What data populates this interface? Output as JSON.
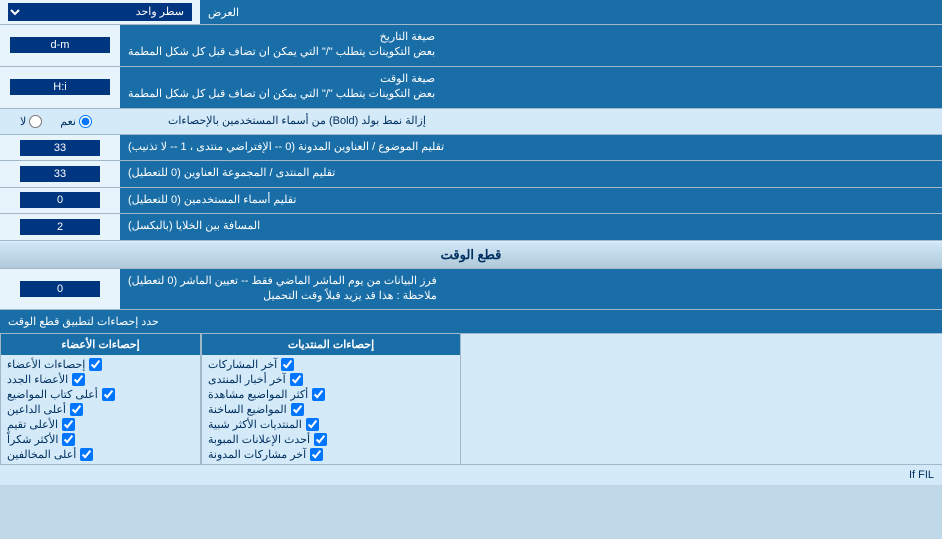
{
  "header": {
    "display_label": "العرض",
    "display_value": "سطر واحد"
  },
  "rows": [
    {
      "label": "صيغة التاريخ\nبعض التكوينات يتطلب \"/\" التي يمكن ان تضاف قبل كل شكل المطمة",
      "input_value": "d-m",
      "input_type": "text"
    },
    {
      "label": "صيغة الوقت\nبعض التكوينات يتطلب \"/\" التي يمكن ان تضاف قبل كل شكل المطمة",
      "input_value": "H:i",
      "input_type": "text"
    }
  ],
  "bold_label": "إزالة نمط بولد (Bold) من أسماء المستخدمين بالإحصاءات",
  "bold_yes": "نعم",
  "bold_no": "لا",
  "rows2": [
    {
      "label": "تقليم الموضوع / العناوين المدونة (0 -- الإفتراضي منتدى ، 1 -- لا تذنيب)",
      "input_value": "33"
    },
    {
      "label": "تقليم المنتدى / المجموعة العناوين (0 للتعطيل)",
      "input_value": "33"
    },
    {
      "label": "تقليم أسماء المستخدمين (0 للتعطيل)",
      "input_value": "0"
    },
    {
      "label": "المسافة بين الخلايا (بالبكسل)",
      "input_value": "2"
    }
  ],
  "section_cutoff": "قطع الوقت",
  "cutoff_row": {
    "label": "فرز البيانات من يوم الماشر الماضي فقط -- تعيين الماشر (0 لتعطيل)\nملاحظة : هذا قد يزيد قبلاً وقت التحميل",
    "input_value": "0"
  },
  "limit_label": "حدد إحصاءات لتطبيق قطع الوقت",
  "checkbox_headers": {
    "col1": "إحصاءات المنتديات",
    "col2": "إحصاءات الأعضاء"
  },
  "checkbox_col1": [
    "آخر المشاركات",
    "آخر أخبار المنتدى",
    "أكثر المواضيع مشاهدة",
    "المواضيع الساخنة",
    "المنتديات الأكثر شبية",
    "أحدث الإعلانات المبوبة",
    "آخر مشاركات المدونة"
  ],
  "checkbox_col2": [
    "إحصاءات الأعضاء",
    "الأعضاء الجدد",
    "أعلى كتاب المواضيع",
    "أعلى الداعين",
    "الأعلى تقيم",
    "الأكثر شكراً",
    "أعلى المخالفين"
  ],
  "if_fil_text": "If FIL"
}
